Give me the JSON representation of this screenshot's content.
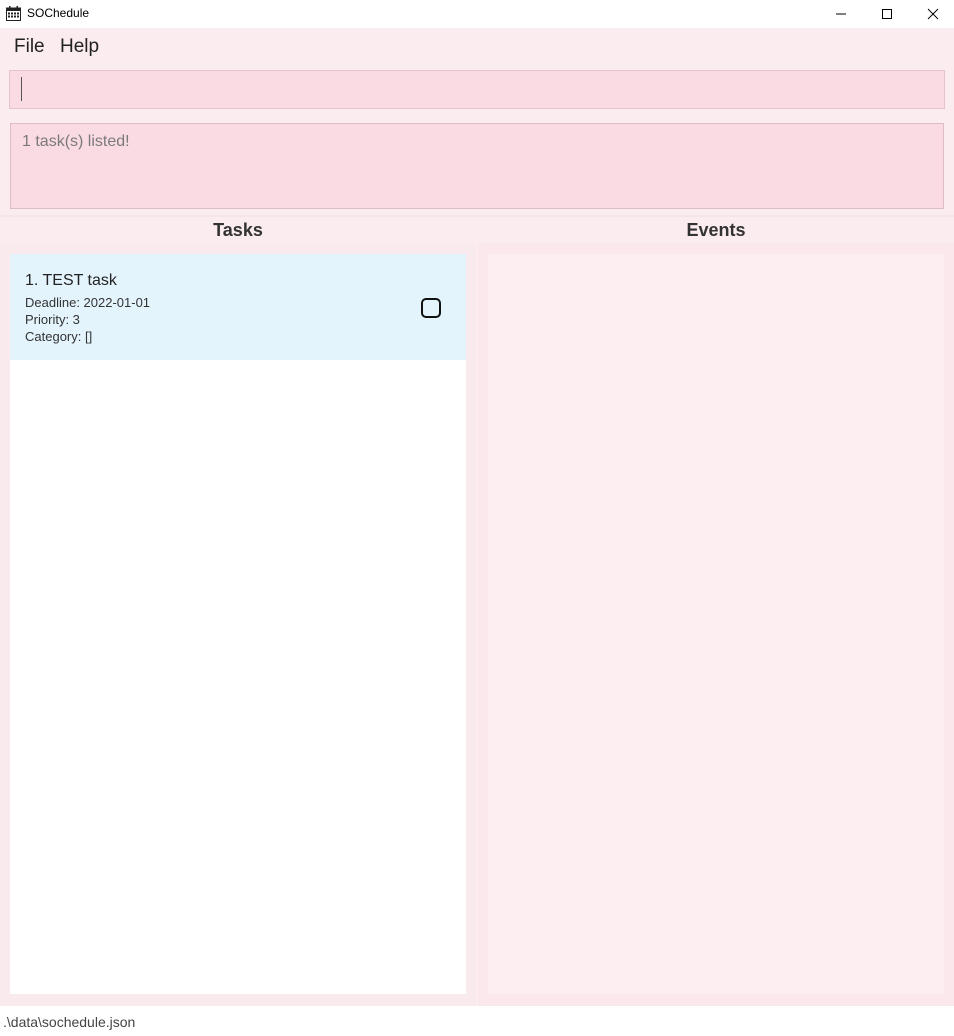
{
  "window": {
    "title": "SOChedule",
    "icons": {
      "app": "calendar-icon",
      "minimize": "minimize-icon",
      "maximize": "maximize-icon",
      "close": "close-icon"
    }
  },
  "menu": {
    "items": [
      {
        "label": "File"
      },
      {
        "label": "Help"
      }
    ]
  },
  "command_box": {
    "value": ""
  },
  "result_display": {
    "text": "1 task(s) listed!"
  },
  "panels": {
    "tasks": {
      "title": "Tasks",
      "items": [
        {
          "title": "1.  TEST task",
          "deadline": "Deadline: 2022-01-01",
          "priority": "Priority: 3",
          "category": "Category: []",
          "completed": false
        }
      ]
    },
    "events": {
      "title": "Events",
      "items": []
    }
  },
  "status_bar": {
    "path": ".\\data\\sochedule.json"
  },
  "colors": {
    "background": "#faecef",
    "input_fill": "#fadbe4",
    "task_card": "#e4f4fd",
    "events_list": "#fdeef1"
  }
}
